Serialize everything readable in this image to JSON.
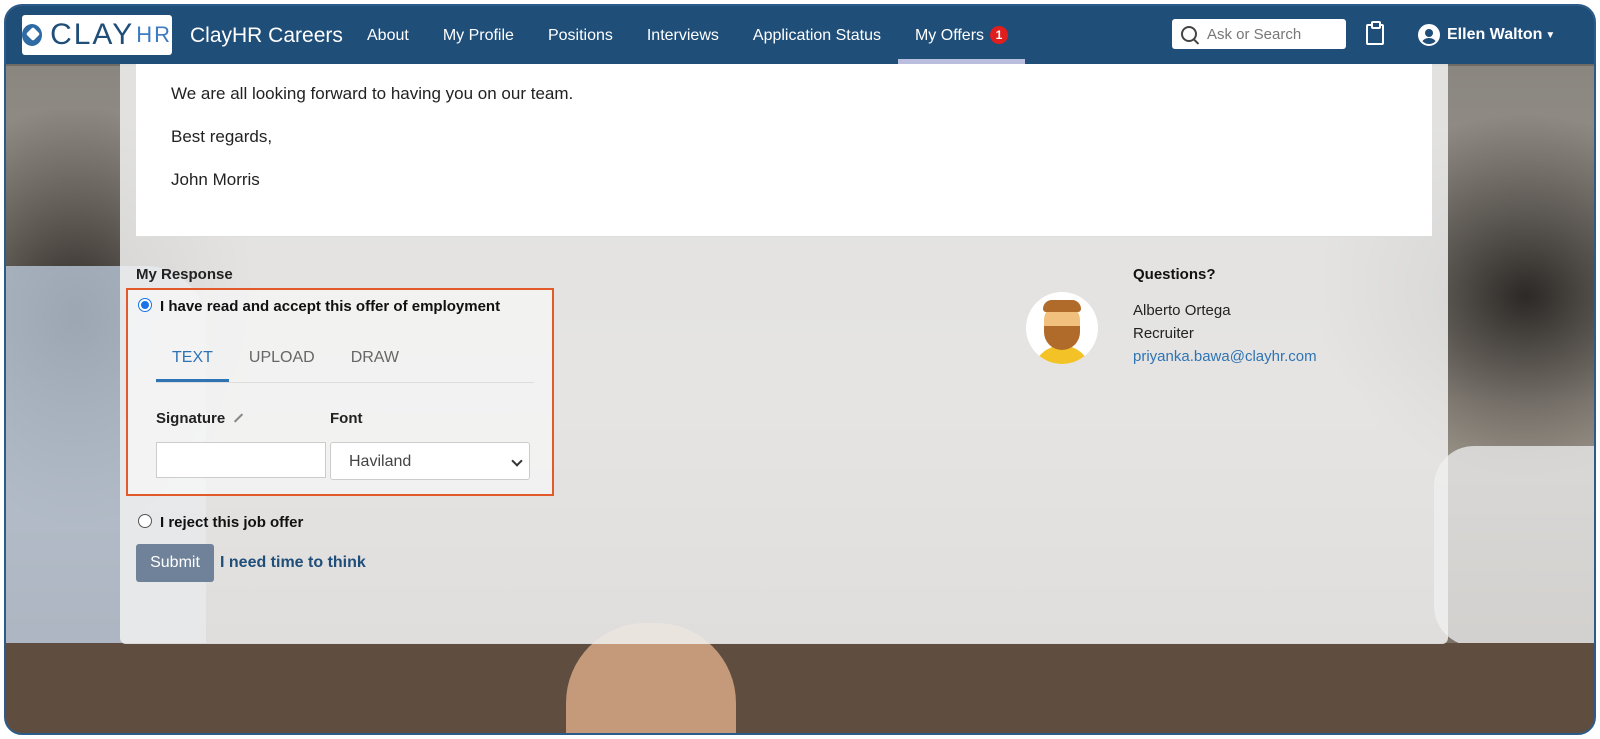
{
  "nav": {
    "logo_text": "CLAY",
    "logo_suffix": "HR",
    "brand": "ClayHR Careers",
    "items": [
      {
        "label": "About"
      },
      {
        "label": "My Profile"
      },
      {
        "label": "Positions"
      },
      {
        "label": "Interviews"
      },
      {
        "label": "Application Status"
      },
      {
        "label": "My Offers",
        "badge": "1",
        "active": true
      }
    ],
    "search_placeholder": "Ask or Search",
    "user_name": "Ellen Walton"
  },
  "letter": {
    "line1": "We are all looking forward to having you on our team.",
    "line2": "Best regards,",
    "line3": "John Morris"
  },
  "response": {
    "title": "My Response",
    "accept_label": "I have read and accept this offer of employment",
    "accept_selected": true,
    "tabs": [
      {
        "label": "TEXT",
        "active": true
      },
      {
        "label": "UPLOAD"
      },
      {
        "label": "DRAW"
      }
    ],
    "signature_label": "Signature",
    "signature_value": "",
    "font_label": "Font",
    "font_value": "Haviland",
    "reject_label": "I reject this job offer",
    "submit_label": "Submit",
    "think_label": "I need time to think"
  },
  "contact": {
    "title": "Questions?",
    "name": "Alberto Ortega",
    "role": "Recruiter",
    "email": "priyanka.bawa@clayhr.com"
  },
  "colors": {
    "nav_bg": "#1f4e79",
    "highlight_border": "#e2592a",
    "accent": "#2e74b5",
    "badge": "#e01e1e"
  }
}
